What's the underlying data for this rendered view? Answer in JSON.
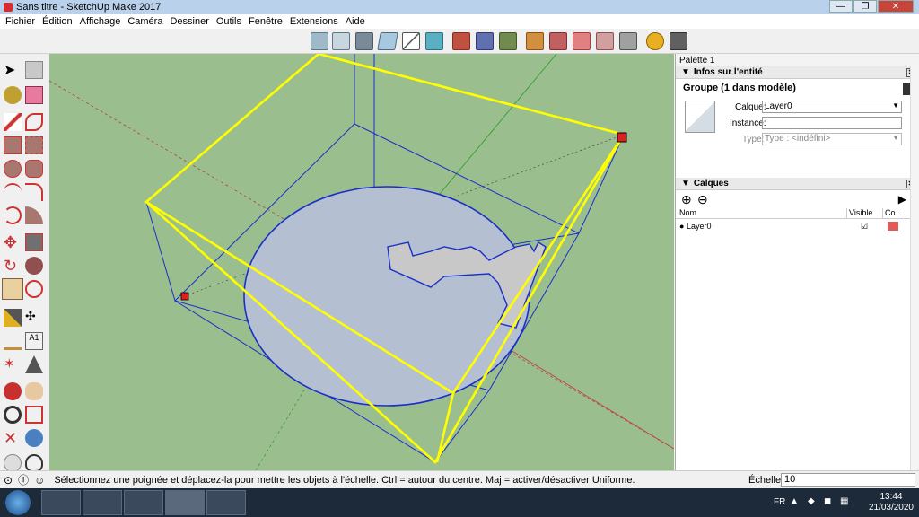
{
  "window": {
    "title": "Sans titre - SketchUp Make 2017"
  },
  "menu": [
    "Fichier",
    "Édition",
    "Affichage",
    "Caméra",
    "Dessiner",
    "Outils",
    "Fenêtre",
    "Extensions",
    "Aide"
  ],
  "panel": {
    "tray_title": "Palette 1",
    "entity_info": {
      "title": "Infos sur l'entité",
      "selection": "Groupe (1 dans modèle)",
      "layer_label": "Calque:",
      "layer_value": "Layer0",
      "instance_label": "Instance:",
      "instance_value": "",
      "type_label": "Type:",
      "type_value": "Type : <indéfini>"
    },
    "layers": {
      "title": "Calques",
      "col_name": "Nom",
      "col_visible": "Visible",
      "col_color": "Co...",
      "rows": [
        {
          "name": "Layer0",
          "visible": true,
          "color": "#e05a5a"
        }
      ]
    }
  },
  "status": {
    "message": "Sélectionnez une poignée et déplacez-la pour mettre les objets à l'échelle. Ctrl = autour du centre. Maj = activer/désactiver Uniforme.",
    "measure_label": "Échelle",
    "measure_value": "10"
  },
  "taskbar": {
    "lang": "FR",
    "time": "13:44",
    "date": "21/03/2020"
  },
  "colors": {
    "viewport": "#9bbe8e",
    "selection": "#ffff00",
    "edges": "#1a2fc8"
  }
}
